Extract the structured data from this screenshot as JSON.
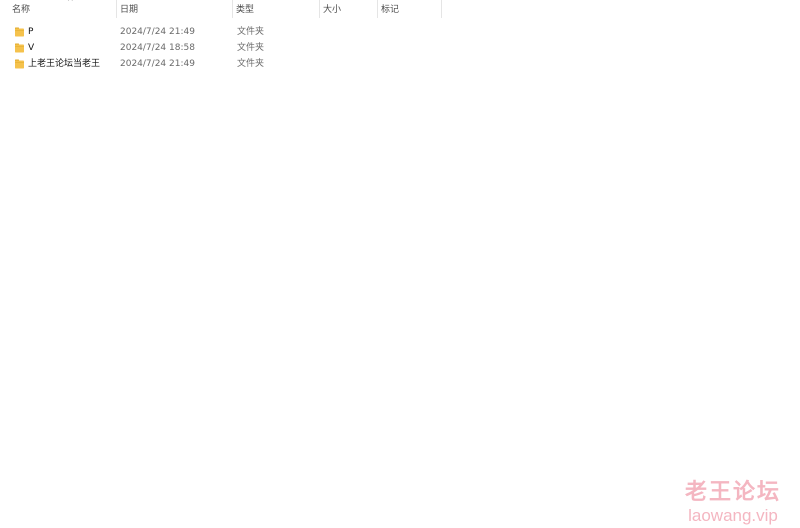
{
  "columns": {
    "name": "名称",
    "date": "日期",
    "type": "类型",
    "size": "大小",
    "tags": "标记",
    "sort_indicator": "^"
  },
  "files": [
    {
      "name": "P",
      "date": "2024/7/24 21:49",
      "type": "文件夹",
      "icon": "folder-icon"
    },
    {
      "name": "V",
      "date": "2024/7/24 18:58",
      "type": "文件夹",
      "icon": "folder-icon"
    },
    {
      "name": "上老王论坛当老王",
      "date": "2024/7/24 21:49",
      "type": "文件夹",
      "icon": "folder-icon"
    }
  ],
  "watermark": {
    "title": "老王论坛",
    "url": "laowang.vip"
  },
  "colors": {
    "folder": "#f5c24c",
    "folder_dark": "#e0a92a",
    "watermark": "#f4b6c1",
    "header_text": "#4c4c4c",
    "secondary_text": "#6a6a6a"
  }
}
